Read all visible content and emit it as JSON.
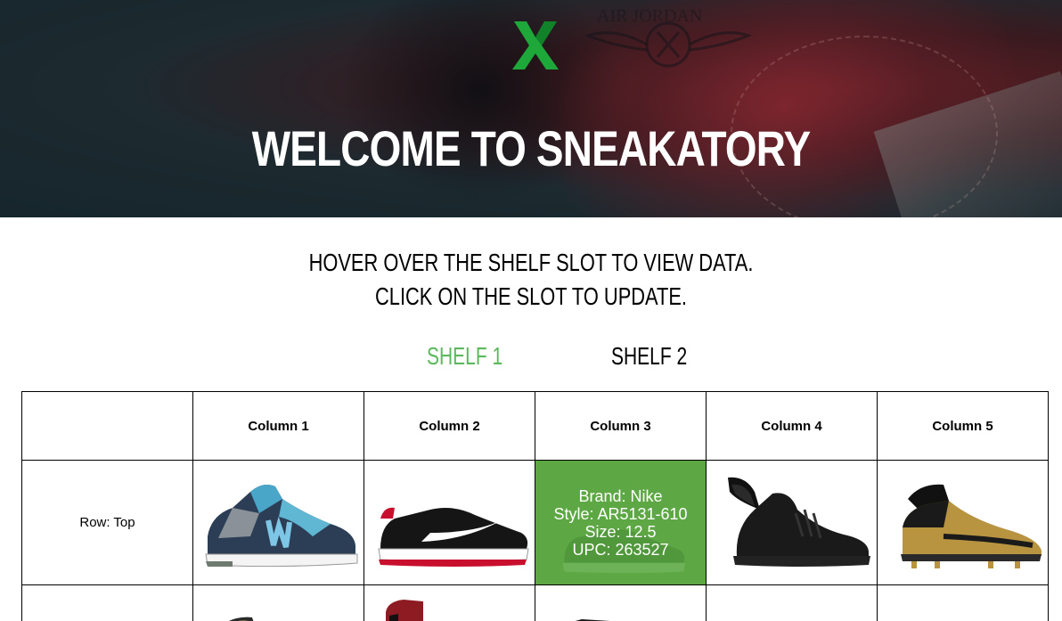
{
  "hero": {
    "title": "Welcome to Sneakatory",
    "logo_icon": "x-logo-icon",
    "accent_color": "#1ea83a"
  },
  "instructions": {
    "line1": "Hover over the shelf slot to view data.",
    "line2": "Click on the slot to update."
  },
  "tabs": [
    {
      "label": "Shelf 1",
      "active": true,
      "color": "#5cb85c"
    },
    {
      "label": "Shelf 2",
      "active": false,
      "color": "#000000"
    }
  ],
  "table": {
    "corner": "",
    "columns": [
      "Column 1",
      "Column 2",
      "Column 3",
      "Column 4",
      "Column 5"
    ],
    "rows": [
      {
        "label": "Row: Top",
        "slots": [
          {
            "icon": "sneaker-new-balance-icon"
          },
          {
            "icon": "sneaker-nike-cortez-icon"
          },
          {
            "icon": "sneaker-nike-cortez-icon",
            "hovered": true,
            "brand": "Brand: Nike",
            "style": "Style: AR5131-610",
            "size": "Size: 12.5",
            "upc": "UPC: 263527"
          },
          {
            "icon": "sneaker-adidas-wings-icon"
          },
          {
            "icon": "cleat-nike-mercurial-icon"
          }
        ]
      },
      {
        "label": "",
        "slots": [
          {
            "icon": "sneaker-icon"
          },
          {
            "icon": "sneaker-jordan-icon"
          },
          {
            "icon": "sneaker-icon"
          },
          {
            "icon": "sneaker-white-icon"
          },
          {
            "icon": ""
          }
        ]
      }
    ],
    "hover_color": "#5da844"
  }
}
